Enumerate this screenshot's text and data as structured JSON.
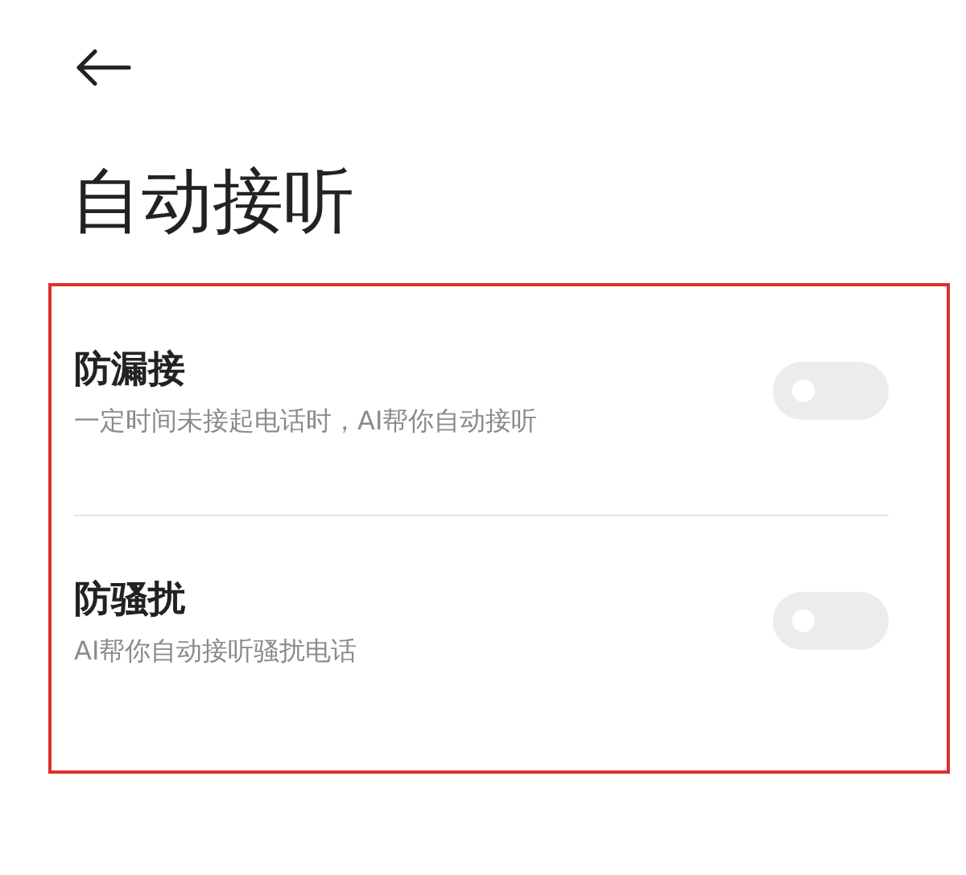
{
  "header": {
    "title": "自动接听"
  },
  "settings": [
    {
      "title": "防漏接",
      "description": "一定时间未接起电话时，AI帮你自动接听",
      "on": false
    },
    {
      "title": "防骚扰",
      "description": "AI帮你自动接听骚扰电话",
      "on": false
    }
  ]
}
